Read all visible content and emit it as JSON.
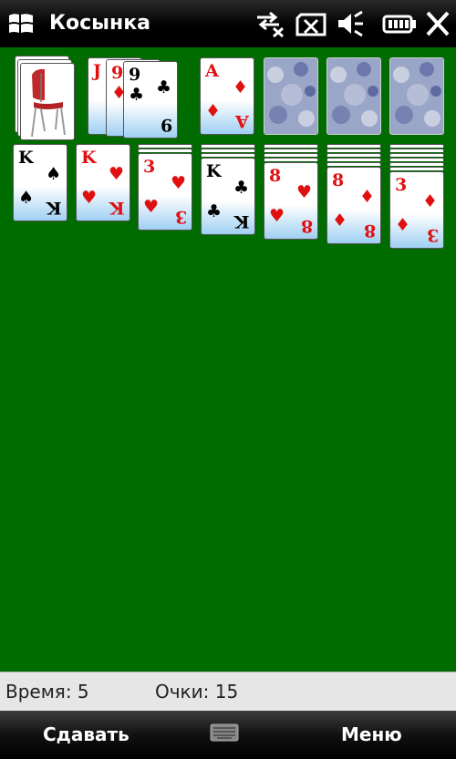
{
  "window": {
    "title": "Косынка"
  },
  "status_icons": [
    "start-icon",
    "data-connection-icon",
    "battery-charging-icon",
    "speaker-muted-icon",
    "battery-icon",
    "close-icon"
  ],
  "colors": {
    "table": "#006c00",
    "red_suit": "#e11010",
    "black_suit": "#000000",
    "card_back": "#8a95b8"
  },
  "stock": {
    "card_back": "chair-picture"
  },
  "waste": {
    "cards": [
      {
        "rank": "J",
        "suit": "♥",
        "color": "red"
      },
      {
        "rank": "9",
        "suit": "♦",
        "color": "red"
      },
      {
        "rank": "9",
        "suit": "♣",
        "color": "black"
      }
    ]
  },
  "foundations": [
    {
      "rank": "A",
      "suit": "♦",
      "color": "red"
    },
    {
      "empty": true
    },
    {
      "empty": true
    },
    {
      "empty": true
    }
  ],
  "tableau": [
    {
      "hidden": 0,
      "rank": "K",
      "suit": "♠",
      "color": "black"
    },
    {
      "hidden": 0,
      "rank": "K",
      "suit": "♥",
      "color": "red"
    },
    {
      "hidden": 2,
      "rank": "3",
      "suit": "♥",
      "color": "red"
    },
    {
      "hidden": 3,
      "rank": "K",
      "suit": "♣",
      "color": "black"
    },
    {
      "hidden": 4,
      "rank": "8",
      "suit": "♥",
      "color": "red"
    },
    {
      "hidden": 5,
      "rank": "8",
      "suit": "♦",
      "color": "red"
    },
    {
      "hidden": 6,
      "rank": "3",
      "suit": "♦",
      "color": "red"
    }
  ],
  "status": {
    "time_label": "Время: 5",
    "score_label": "Очки: 15"
  },
  "softkeys": {
    "left": "Сдавать",
    "right": "Меню"
  }
}
